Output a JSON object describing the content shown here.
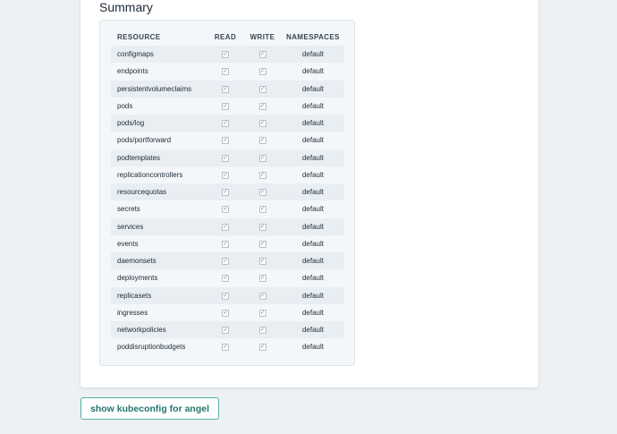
{
  "summary": {
    "title": "Summary",
    "columns": [
      "RESOURCE",
      "READ",
      "WRITE",
      "NAMESPACES"
    ],
    "rows": [
      {
        "resource": "configmaps",
        "read": true,
        "write": true,
        "namespace": "default"
      },
      {
        "resource": "endpoints",
        "read": true,
        "write": true,
        "namespace": "default"
      },
      {
        "resource": "persistentvolumeclaims",
        "read": true,
        "write": true,
        "namespace": "default"
      },
      {
        "resource": "pods",
        "read": true,
        "write": true,
        "namespace": "default"
      },
      {
        "resource": "pods/log",
        "read": true,
        "write": true,
        "namespace": "default"
      },
      {
        "resource": "pods/portforward",
        "read": true,
        "write": true,
        "namespace": "default"
      },
      {
        "resource": "podtemplates",
        "read": true,
        "write": true,
        "namespace": "default"
      },
      {
        "resource": "replicationcontrollers",
        "read": true,
        "write": true,
        "namespace": "default"
      },
      {
        "resource": "resourcequotas",
        "read": true,
        "write": true,
        "namespace": "default"
      },
      {
        "resource": "secrets",
        "read": true,
        "write": true,
        "namespace": "default"
      },
      {
        "resource": "services",
        "read": true,
        "write": true,
        "namespace": "default"
      },
      {
        "resource": "events",
        "read": true,
        "write": true,
        "namespace": "default"
      },
      {
        "resource": "daemonsets",
        "read": true,
        "write": true,
        "namespace": "default"
      },
      {
        "resource": "deployments",
        "read": true,
        "write": true,
        "namespace": "default"
      },
      {
        "resource": "replicasets",
        "read": true,
        "write": true,
        "namespace": "default"
      },
      {
        "resource": "ingresses",
        "read": true,
        "write": true,
        "namespace": "default"
      },
      {
        "resource": "networkpolicies",
        "read": true,
        "write": true,
        "namespace": "default"
      },
      {
        "resource": "poddisruptionbudgets",
        "read": true,
        "write": true,
        "namespace": "default"
      }
    ]
  },
  "actions": {
    "kubeconfig_label": "show kubeconfig for angel"
  },
  "colors": {
    "background": "#eef1f4",
    "accent": "#22776d",
    "button_border": "#55b0a6"
  },
  "icons": {
    "checkbox": "checkbox-checked-icon",
    "check_glyph": "✓"
  }
}
